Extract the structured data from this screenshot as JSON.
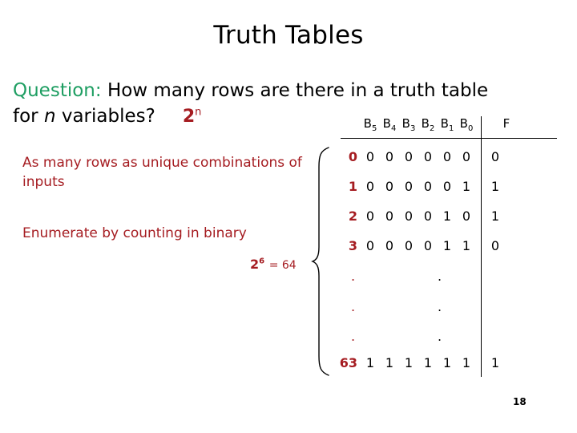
{
  "slide": {
    "title": "Truth Tables",
    "page_number": "18"
  },
  "question": {
    "label": "Question:",
    "line1_text": "How many rows are there in a truth table",
    "line2_prefix": "for",
    "line2_variable": "n",
    "line2_suffix": "variables?",
    "answer_base": "2",
    "answer_exponent": "n",
    "label_color": "#1e9e62",
    "answer_color": "#a51c21"
  },
  "notes": {
    "note1": "As many rows as unique combinations of inputs",
    "note2": "Enumerate by counting in binary",
    "power_base": "2",
    "power_exponent": "6",
    "power_equals": "= 64",
    "color": "#a51c21"
  },
  "table": {
    "headers": [
      "B",
      "B",
      "B",
      "B",
      "B",
      "B"
    ],
    "header_subscripts": [
      "5",
      "4",
      "3",
      "2",
      "1",
      "0"
    ],
    "output_header": "F",
    "rows": [
      {
        "index": "0",
        "bits": [
          "0",
          "0",
          "0",
          "0",
          "0",
          "0"
        ],
        "f": "0"
      },
      {
        "index": "1",
        "bits": [
          "0",
          "0",
          "0",
          "0",
          "0",
          "1"
        ],
        "f": "1"
      },
      {
        "index": "2",
        "bits": [
          "0",
          "0",
          "0",
          "0",
          "1",
          "0"
        ],
        "f": "1"
      },
      {
        "index": "3",
        "bits": [
          "0",
          "0",
          "0",
          "0",
          "1",
          "1"
        ],
        "f": "0"
      },
      {
        "index": "63",
        "bits": [
          "1",
          "1",
          "1",
          "1",
          "1",
          "1"
        ],
        "f": "1"
      }
    ],
    "ellipsis_dot": "."
  }
}
